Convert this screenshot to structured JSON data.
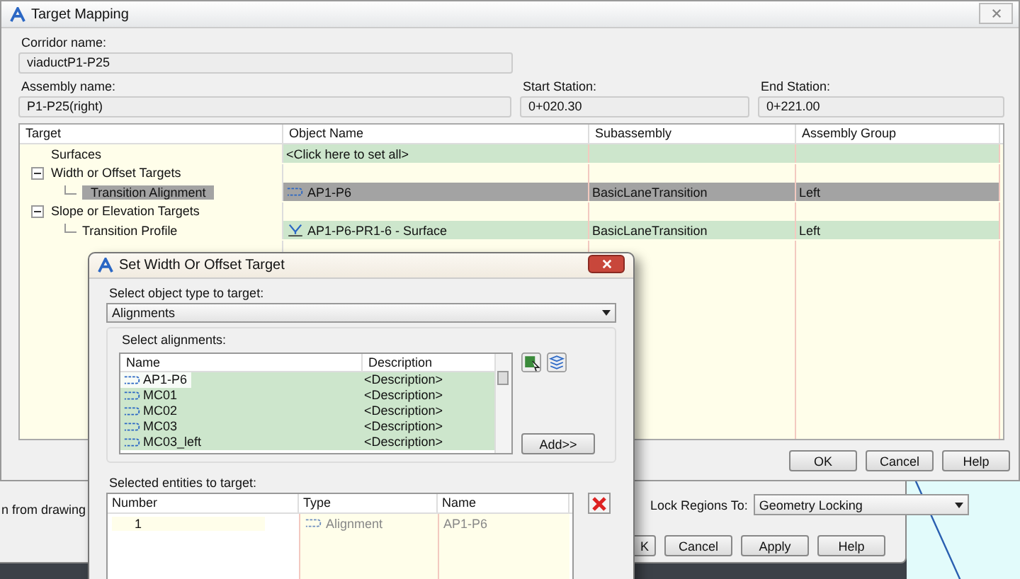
{
  "target_mapping": {
    "title": "Target Mapping",
    "corridor_label": "Corridor name:",
    "corridor_name": "viaductP1-P25",
    "assembly_label": "Assembly name:",
    "assembly_name": "P1-P25(right)",
    "start_label": "Start Station:",
    "start_station": "0+020.30",
    "end_label": "End Station:",
    "end_station": "0+221.00",
    "columns": [
      "Target",
      "Object Name",
      "Subassembly",
      "Assembly Group"
    ],
    "targets": [
      {
        "label": "Surfaces",
        "object_name": "<Click here to set all>",
        "highlighted": true,
        "selected": false
      },
      {
        "label": "Width or Offset Targets",
        "expanded": true,
        "selected": false,
        "children": [
          {
            "label": "Transition Alignment",
            "object_name": "AP1-P6",
            "kind": "alignment",
            "subassembly": "BasicLaneTransition",
            "assembly_group": "Left",
            "highlighted": true,
            "selected": true
          }
        ]
      },
      {
        "label": "Slope or Elevation Targets",
        "expanded": true,
        "selected": false,
        "children": [
          {
            "label": "Transition Profile",
            "object_name": "AP1-P6-PR1-6 - Surface",
            "kind": "profile",
            "subassembly": "BasicLaneTransition",
            "assembly_group": "Left",
            "highlighted": true,
            "selected": false
          }
        ]
      }
    ],
    "buttons": [
      "OK",
      "Cancel",
      "Help"
    ]
  },
  "offset_dialog": {
    "title": "Set Width Or Offset Target",
    "type_label": "Select object type to target:",
    "object_type": "Alignments",
    "group_label": "Select alignments:",
    "list_columns": [
      "Name",
      "Description"
    ],
    "alignments": [
      {
        "name": "AP1-P6",
        "description": "<Description>",
        "selected": true,
        "focused": true
      },
      {
        "name": "MC01",
        "description": "<Description>",
        "selected": true,
        "focused": false
      },
      {
        "name": "MC02",
        "description": "<Description>",
        "selected": true,
        "focused": false
      },
      {
        "name": "MC03",
        "description": "<Description>",
        "selected": true,
        "focused": false
      },
      {
        "name": "MC03_left",
        "description": "<Description>",
        "selected": true,
        "focused": false
      }
    ],
    "add_button": "Add>>",
    "selected_label": "Selected entities to target:",
    "entity_columns": [
      "Number",
      "Type",
      "Name"
    ],
    "entities": [
      {
        "number": "1",
        "type": "Alignment",
        "name": "AP1-P6"
      }
    ]
  },
  "background_dialog": {
    "partial_text": "n from drawing",
    "lock_label": "Lock Regions To:",
    "lock_value": "Geometry Locking",
    "buttons": [
      "K",
      "Cancel",
      "Apply",
      "Help"
    ]
  }
}
